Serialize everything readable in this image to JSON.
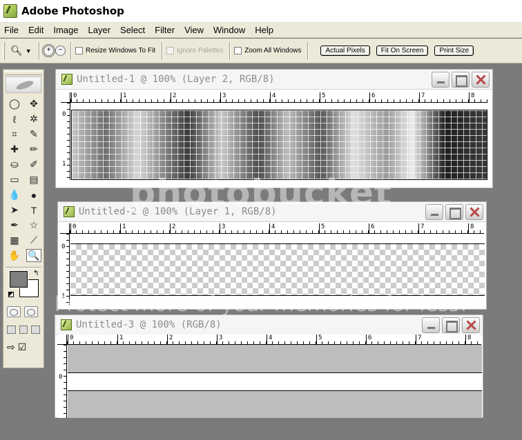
{
  "app": {
    "title": "Adobe Photoshop"
  },
  "menu": [
    "File",
    "Edit",
    "Image",
    "Layer",
    "Select",
    "Filter",
    "View",
    "Window",
    "Help"
  ],
  "options": {
    "resize_windows_label": "Resize Windows To Fit",
    "ignore_palettes_label": "Ignore Palettes",
    "zoom_all_label": "Zoom All Windows",
    "actual_pixels_label": "Actual Pixels",
    "fit_on_screen_label": "Fit On Screen",
    "print_size_label": "Print Size"
  },
  "toolbox": {
    "tools": [
      {
        "name": "marquee-icon",
        "glyph": "◯"
      },
      {
        "name": "move-icon",
        "glyph": "✥"
      },
      {
        "name": "lasso-icon",
        "glyph": "ℓ"
      },
      {
        "name": "magic-wand-icon",
        "glyph": "✲"
      },
      {
        "name": "crop-icon",
        "glyph": "⌗"
      },
      {
        "name": "slice-icon",
        "glyph": "✎"
      },
      {
        "name": "healing-brush-icon",
        "glyph": "✚"
      },
      {
        "name": "brush-icon",
        "glyph": "✏"
      },
      {
        "name": "stamp-icon",
        "glyph": "⛀"
      },
      {
        "name": "history-brush-icon",
        "glyph": "✐"
      },
      {
        "name": "eraser-icon",
        "glyph": "▭"
      },
      {
        "name": "gradient-icon",
        "glyph": "▤"
      },
      {
        "name": "blur-icon",
        "glyph": "💧"
      },
      {
        "name": "dodge-icon",
        "glyph": "●"
      },
      {
        "name": "path-selection-icon",
        "glyph": "➤"
      },
      {
        "name": "type-icon",
        "glyph": "T"
      },
      {
        "name": "pen-icon",
        "glyph": "✒"
      },
      {
        "name": "shape-icon",
        "glyph": "☆"
      },
      {
        "name": "notes-icon",
        "glyph": "▦"
      },
      {
        "name": "eyedropper-icon",
        "glyph": "⟋"
      },
      {
        "name": "hand-icon",
        "glyph": "✋"
      },
      {
        "name": "zoom-icon",
        "glyph": "🔍"
      }
    ],
    "colors": {
      "foreground": "#7f7f7f",
      "background": "#ffffff"
    }
  },
  "documents": [
    {
      "title": "Untitled-1 @ 100% (Layer 2, RGB/8)",
      "ruler_labels": [
        "0",
        "1",
        "2",
        "3",
        "4",
        "5",
        "6",
        "7",
        "8"
      ],
      "vruler": [
        "0",
        "1"
      ]
    },
    {
      "title": "Untitled-2 @ 100% (Layer 1, RGB/8)",
      "ruler_labels": [
        "0",
        "1",
        "2",
        "3",
        "4",
        "5",
        "6",
        "7",
        "8"
      ],
      "vruler": [
        "0",
        "1"
      ]
    },
    {
      "title": "Untitled-3 @ 100% (RGB/8)",
      "ruler_labels": [
        "0",
        "1",
        "2",
        "3",
        "4",
        "5",
        "6",
        "7",
        "8"
      ],
      "vruler": [
        "0"
      ]
    }
  ],
  "watermark": {
    "logo": "photobucket",
    "tagline": "Protect more of your memories for less!"
  }
}
